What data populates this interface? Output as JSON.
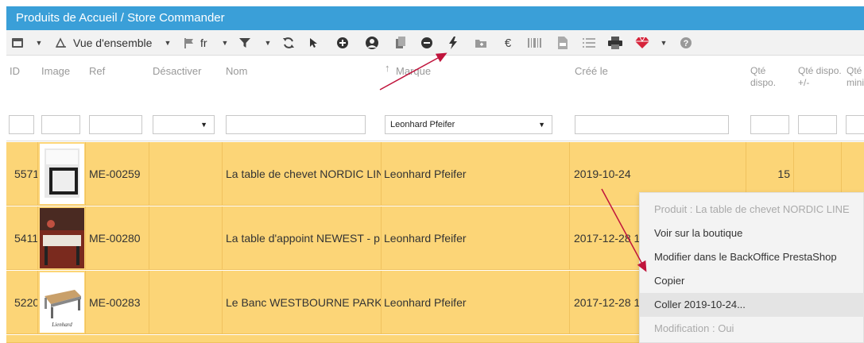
{
  "window": {
    "title": "Produits de Accueil / Store Commander"
  },
  "toolbar": {
    "view_label": "Vue d'ensemble",
    "lang_label": "fr",
    "icons": [
      "menu-icon",
      "table-icon",
      "flag-icon",
      "filter-icon",
      "refresh-icon",
      "cursor-icon",
      "add-icon",
      "user-settings-icon",
      "copy-icon",
      "minus-icon",
      "lightning-icon",
      "add-folder-icon",
      "euro-icon",
      "barcode-icon",
      "csv-icon",
      "list-icon",
      "print-icon",
      "gem-icon",
      "help-icon"
    ]
  },
  "columns": {
    "id": "ID",
    "image": "Image",
    "ref": "Ref",
    "desactiver": "Désactiver",
    "nom": "Nom",
    "marque": "Marque",
    "cree": "Créé le",
    "qte_dispo": "Qté dispo.",
    "qte_dispo_pm": "Qté dispo. +/-",
    "qte_mini": "Qté mini"
  },
  "filters": {
    "marque_value": "Leonhard Pfeifer"
  },
  "rows": [
    {
      "id": "5571",
      "ref": "ME-00259",
      "nom": "La table de chevet NORDIC LINE",
      "marque": "Leonhard Pfeifer",
      "cree": "2019-10-24",
      "qte": "15"
    },
    {
      "id": "5411",
      "ref": "ME-00280",
      "nom": "La table d'appoint NEWEST - p",
      "marque": "Leonhard Pfeifer",
      "cree": "2017-12-28 1",
      "qte": ""
    },
    {
      "id": "5220",
      "ref": "ME-00283",
      "nom": "Le Banc WESTBOURNE PARK",
      "marque": "Leonhard Pfeifer",
      "cree": "2017-12-28 1",
      "qte": ""
    }
  ],
  "context_menu": {
    "items": [
      {
        "label": "Produit : La table de chevet NORDIC LINE",
        "disabled": true
      },
      {
        "label": "Voir sur la boutique",
        "disabled": false
      },
      {
        "label": "Modifier dans le BackOffice PrestaShop",
        "disabled": false
      },
      {
        "label": "Copier",
        "disabled": false
      },
      {
        "label": "Coller 2019-10-24...",
        "disabled": false
      },
      {
        "label": "Modification : Oui",
        "disabled": true
      }
    ]
  },
  "colors": {
    "titlebar": "#3a9fd8",
    "row_bg": "#fcd577",
    "arrow": "#c0143c"
  }
}
